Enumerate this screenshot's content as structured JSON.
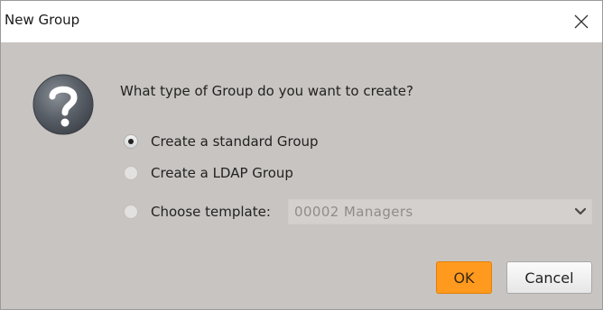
{
  "window": {
    "title": "New Group"
  },
  "dialog": {
    "question": "What type of Group do you want to create?",
    "options": [
      {
        "label": "Create a standard Group",
        "selected": true
      },
      {
        "label": "Create a LDAP Group",
        "selected": false
      },
      {
        "label": "Choose template:",
        "selected": false
      }
    ],
    "template_select": {
      "value": "00002  Managers",
      "enabled": false
    }
  },
  "buttons": {
    "ok_label": "OK",
    "cancel_label": "Cancel"
  },
  "colors": {
    "dialog_bg": "#c8c4c1",
    "ok_button": "#ff9a1f"
  },
  "icons": {
    "close": "close-icon",
    "question": "question-mark-icon",
    "dropdown": "chevron-down-icon"
  }
}
